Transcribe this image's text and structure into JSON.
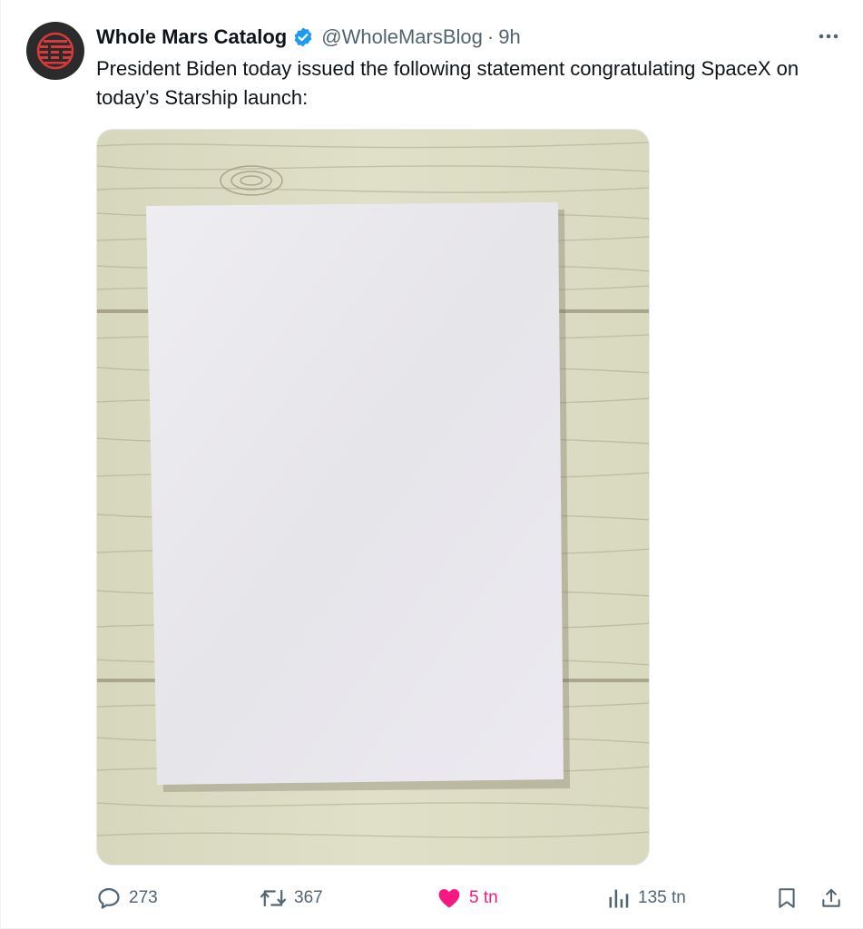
{
  "tweet": {
    "author_name": "Whole Mars Catalog",
    "handle": "@WholeMarsBlog",
    "separator": "·",
    "timestamp": "9h",
    "text": "President Biden today issued the following statement congratulating SpaceX on today’s Starship launch:",
    "media": {
      "icon": "blank-paper-on-wood-image"
    }
  },
  "actions": {
    "reply": {
      "icon": "reply-icon",
      "count": "273"
    },
    "retweet": {
      "icon": "retweet-icon",
      "count": "367"
    },
    "like": {
      "icon": "heart-icon",
      "count": "5 tn",
      "active": true
    },
    "views": {
      "icon": "views-icon",
      "count": "135 tn"
    },
    "bookmark": {
      "icon": "bookmark-icon"
    },
    "share": {
      "icon": "share-icon"
    }
  },
  "colors": {
    "text_primary": "#0f1419",
    "text_secondary": "#536471",
    "verified_blue": "#1d9bf0",
    "like_pink": "#f91880",
    "avatar_bg": "#2b2b2b",
    "avatar_red": "#d73a3a",
    "wood": "#dcdcc2",
    "paper": "#eceaf0"
  }
}
